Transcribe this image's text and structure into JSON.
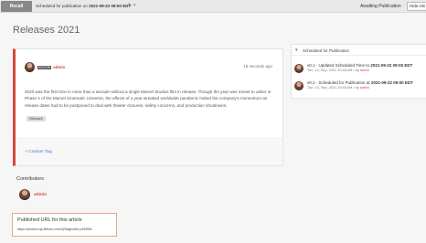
{
  "topbar": {
    "recall_label": "Recall",
    "scheduled_prefix": "Scheduled for publication on",
    "scheduled_time": "2021-09-22 09:00 EDT",
    "pencil_icon": "✎",
    "close_icon": "×",
    "status": "Awaiting Publication",
    "hide_label": "Hide His"
  },
  "page": {
    "title": "Releases 2021"
  },
  "post": {
    "author_role": "EDITOR",
    "author_name": "admin",
    "timestamp": "18 seconds ago",
    "body": "2020 was the first time in more than a decade without a single Marvel Studios film in release. Though the year was meant to usher in Phase 4 of the Marvel Cinematic Universe, the effects of a year wreaked worldwide pandemic halted the company's momentum as release dates had to be postponed to deal with theater closures, safety concerns, and production shutdowns.",
    "tag": "Releases",
    "custom_tag_label": "+ Custom Tag"
  },
  "contributors": {
    "title": "Contributors",
    "items": [
      {
        "name": "admin"
      }
    ]
  },
  "published": {
    "title": "Published URL for this article",
    "url": "https://product.qa.liblium.com/r/j/9agiroUtu-p/hb554"
  },
  "history": {
    "title": "Scheduled for Publication",
    "chevron": "▾",
    "events": [
      {
        "text": "v0.1 - Updated Scheduled Time to",
        "value": "2021-09-22 09:00 EDT",
        "date": "Tue, 14, Sep, 2021 10:48 AM",
        "by_prefix": "• by",
        "by": "admin"
      },
      {
        "text": "v0.1 - Scheduled for Publication at",
        "value": "2021-09-22 09:00 EDT",
        "date": "Tue, 14, Sep, 2021 10:48 AM",
        "by_prefix": "• by",
        "by": "admin"
      }
    ]
  },
  "colors": {
    "accent": "#d64a3c",
    "link": "#3a7bd5",
    "button": "#888888"
  }
}
